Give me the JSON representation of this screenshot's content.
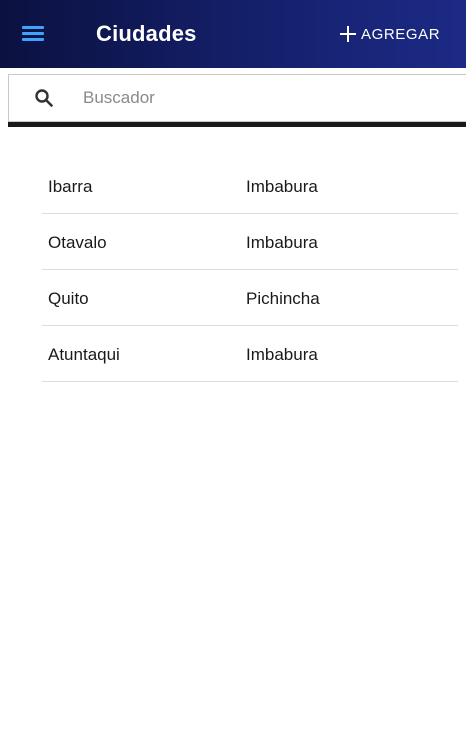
{
  "header": {
    "title": "Ciudades",
    "add_label": "AGREGAR",
    "menu_icon": "hamburger-icon",
    "add_icon": "plus-icon"
  },
  "search": {
    "placeholder": "Buscador",
    "value": "",
    "icon": "search-icon"
  },
  "cities": {
    "rows": [
      {
        "name": "Ibarra",
        "province": "Imbabura"
      },
      {
        "name": "Otavalo",
        "province": "Imbabura"
      },
      {
        "name": "Quito",
        "province": "Pichincha"
      },
      {
        "name": "Atuntaqui",
        "province": "Imbabura"
      }
    ]
  },
  "colors": {
    "header_bg_start": "#0b1140",
    "header_bg_end": "#1c2a86",
    "menu_icon": "#3ea3ff",
    "header_text": "#ffffff",
    "divider": "#dcdcdc"
  }
}
